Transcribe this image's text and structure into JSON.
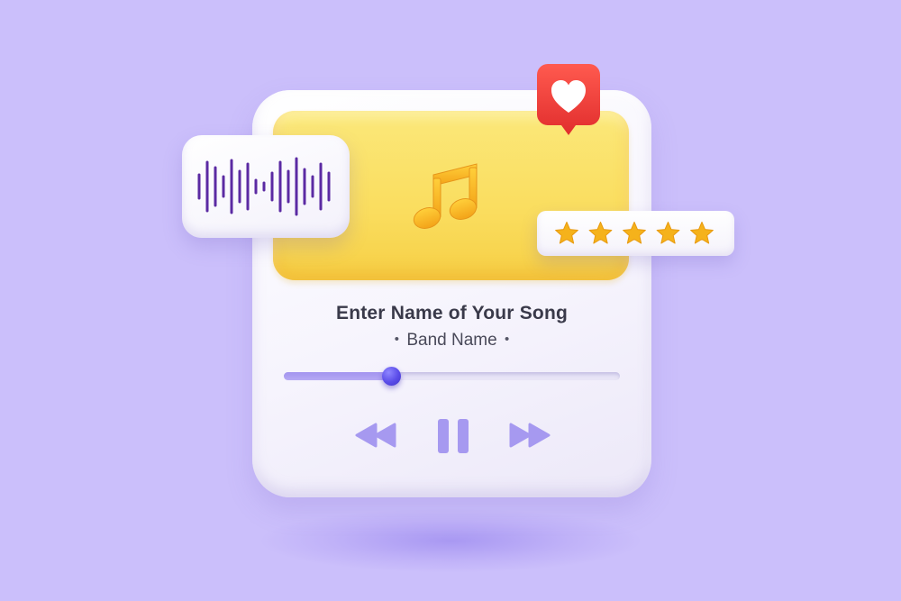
{
  "player": {
    "song_title": "Enter Name of Your Song",
    "band_name": "Band Name",
    "bullet": "•",
    "progress": 0.32
  },
  "rating": {
    "stars": 5,
    "max_stars": 5
  },
  "icons": {
    "music": "music-note-icon",
    "waveform": "waveform-icon",
    "like": "heart-icon",
    "star": "star-icon",
    "rewind": "rewind-icon",
    "pause": "pause-icon",
    "forward": "fast-forward-icon"
  },
  "colors": {
    "background": "#cbbffb",
    "card": "#f6f4fd",
    "album_art": "#fadd5e",
    "accent": "#5a4ce8",
    "controls": "#a699f0",
    "like_badge": "#ee3a3a",
    "star": "#f5b21b"
  }
}
